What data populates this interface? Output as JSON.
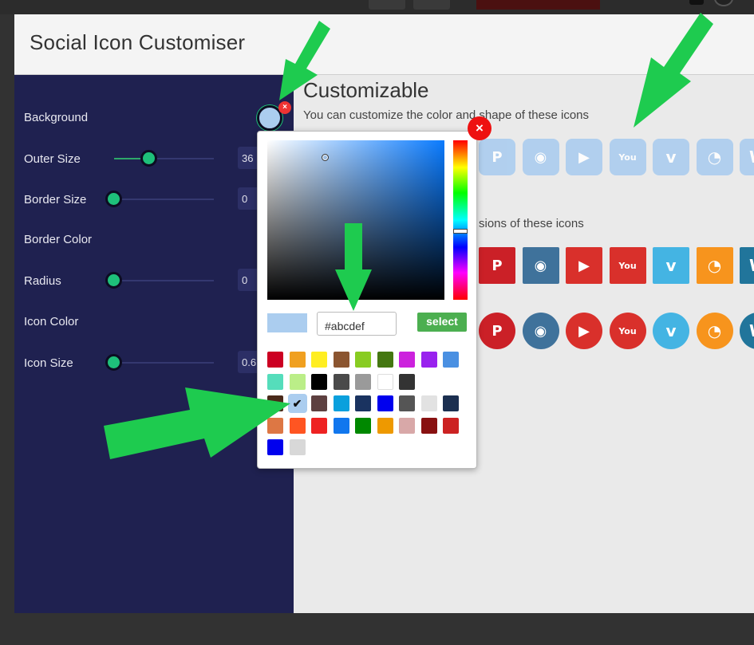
{
  "app": {
    "title": "Social Icon Customiser"
  },
  "sidebar": {
    "rows": [
      {
        "label": "Background"
      },
      {
        "label": "Outer Size",
        "value": "36",
        "percent": 34
      },
      {
        "label": "Border Size",
        "value": "0",
        "percent": 0
      },
      {
        "label": "Border Color"
      },
      {
        "label": "Radius",
        "value": "0",
        "percent": 0
      },
      {
        "label": "Icon Color"
      },
      {
        "label": "Icon Size",
        "value": "0.6",
        "percent": 0
      }
    ],
    "background_color": "#abcdef",
    "background_close": "×"
  },
  "content": {
    "title": "Customizable",
    "description": "You can customize the color and shape of these icons",
    "description2": "sions of these icons"
  },
  "icons": {
    "rows": [
      {
        "variant": "light",
        "names": [
          "pinterest-icon",
          "instagram-icon",
          "youtube-icon",
          "youtube-classic-icon",
          "vimeo-icon",
          "rss-icon",
          "wordpress-icon"
        ]
      },
      {
        "variant": "square",
        "names": [
          "pinterest-icon",
          "instagram-icon",
          "youtube-icon",
          "youtube-classic-icon",
          "vimeo-icon",
          "rss-icon",
          "wordpress-icon"
        ]
      },
      {
        "variant": "round",
        "names": [
          "pinterest-icon",
          "instagram-icon",
          "youtube-icon",
          "youtube-classic-icon",
          "vimeo-icon",
          "rss-icon",
          "wordpress-icon"
        ]
      }
    ],
    "brand_colors": [
      "#cb2027",
      "#3f729b",
      "#d9302b",
      "#d9302b",
      "#44b4e3",
      "#f7941d",
      "#21759b"
    ],
    "light_color": "#abcdef"
  },
  "picker": {
    "close_label": "×",
    "hex_value": "#abcdef",
    "select_label": "select",
    "preview_color": "#abcdef",
    "palette": [
      [
        "#cc0022",
        "#f0a020",
        "#ffee22",
        "#8b5530",
        "#88cc22",
        "#447711",
        "#cc22dd",
        "#9922ee",
        "#4a90e2"
      ],
      [
        "#55ddbb",
        "#bbee88",
        "#000000",
        "#4a4a4a",
        "#9a9a9a",
        "#ffffff",
        "#333333"
      ],
      [
        "#4a2a1a",
        "#abcdef",
        "#5d4040",
        "#0aa0dd",
        "#1a3360",
        "#0000ee",
        "#555555",
        "#e2e2e2",
        "#1b2f50"
      ],
      [
        "#dd7744",
        "#ff5522",
        "#ee2222",
        "#1177ee",
        "#008800",
        "#ee9900",
        "#d8a8a8",
        "#881111",
        "#cc2222"
      ],
      [
        "#0000ee",
        "#d8d8d8"
      ]
    ],
    "selected": "#abcdef"
  }
}
